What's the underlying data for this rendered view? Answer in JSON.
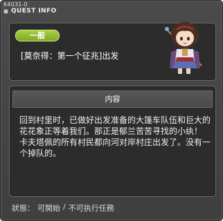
{
  "window": {
    "quest_id": "64031-0",
    "title": "QUEST INFO"
  },
  "quest": {
    "category": "一般",
    "name": "[莫奈得：第一个征兆]出发"
  },
  "content": {
    "header": "内容",
    "lines": [
      "回到村里时，已做好出发准备的大篷车队伍和巨大的花花象正等着我们。那正是郁兰苦苦寻找的小纨！",
      "卡夫塔佩的所有村民都向河对岸村庄出发了。没有一个掉队的。"
    ]
  },
  "status": {
    "label": "狀態：",
    "start": "可開始",
    "separator": "/",
    "complete": "不可执行任務"
  },
  "colors": {
    "window_bg": "#444444",
    "panel_bg": "#2c2c2c",
    "badge_green": "#8fba32",
    "text": "#ffffff"
  },
  "icons": {
    "npc": "npc-girl-portrait",
    "title_marker": "square-bullet-icon"
  }
}
